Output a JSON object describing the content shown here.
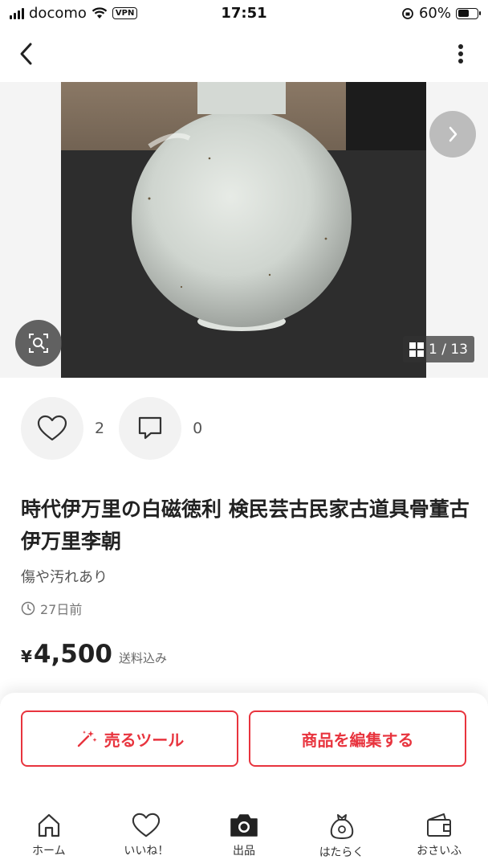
{
  "status_bar": {
    "carrier": "docomo",
    "vpn": "VPN",
    "time": "17:51",
    "battery": "60%",
    "battery_level": 0.6
  },
  "header": {
    "back_icon": "chevron-left-icon",
    "more_icon": "vertical-dots-icon"
  },
  "gallery": {
    "counter": "1 / 13",
    "next_icon": "chevron-right-icon",
    "zoom_icon": "image-search-icon"
  },
  "actions": {
    "like_count": "2",
    "comment_count": "0"
  },
  "item": {
    "title": "時代伊万里の白磁徳利 検民芸古民家古道具骨董古伊万里李朝",
    "condition": "傷や汚れあり",
    "posted": "27日前",
    "currency": "¥",
    "price": "4,500",
    "shipping": "送料込み"
  },
  "buttons": {
    "sell_tool": "売るツール",
    "edit_item": "商品を編集する"
  },
  "tabs": [
    {
      "label": "ホーム",
      "icon": "home-icon"
    },
    {
      "label": "いいね！",
      "icon": "heart-icon"
    },
    {
      "label": "出品",
      "icon": "camera-icon"
    },
    {
      "label": "はたらく",
      "icon": "money-bag-icon"
    },
    {
      "label": "おさいふ",
      "icon": "wallet-icon"
    }
  ],
  "colors": {
    "accent": "#e8343e",
    "text": "#222222"
  }
}
